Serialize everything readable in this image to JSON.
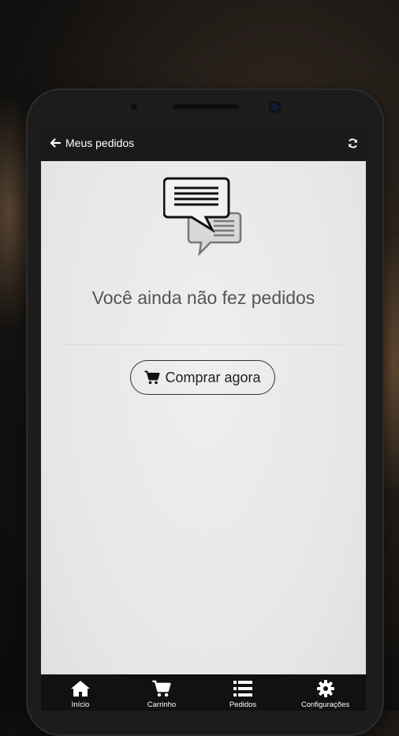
{
  "appbar": {
    "title": "Meus pedidos",
    "back_icon": "arrow-left-icon",
    "refresh_icon": "refresh-icon"
  },
  "empty_state": {
    "illustration_icon": "chat-bubbles-icon",
    "message": "Você ainda não fez pedidos"
  },
  "buy_button": {
    "label": "Comprar agora",
    "icon": "cart-icon"
  },
  "bottom_nav": {
    "items": [
      {
        "label": "Início",
        "icon": "home-icon"
      },
      {
        "label": "Carrinho",
        "icon": "cart-icon"
      },
      {
        "label": "Pedidos",
        "icon": "list-icon"
      },
      {
        "label": "Configurações",
        "icon": "gear-icon"
      }
    ]
  },
  "colors": {
    "appbar_bg": "#1a1a1a",
    "screen_bg": "#e8e8e8",
    "bottom_nav_bg": "#111111"
  }
}
